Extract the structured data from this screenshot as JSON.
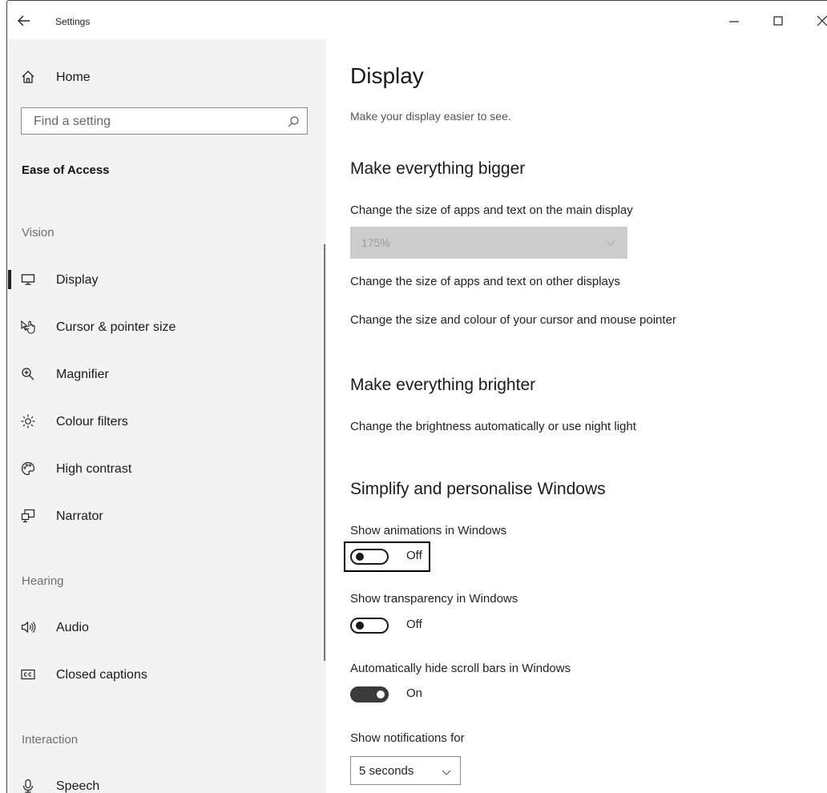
{
  "window": {
    "title": "Settings",
    "controls": {
      "minimize": "minimize-icon",
      "maximize": "maximize-icon",
      "close": "close-icon"
    }
  },
  "sidebar": {
    "home_label": "Home",
    "search_placeholder": "Find a setting",
    "section_title": "Ease of Access",
    "groups": {
      "vision": "Vision",
      "hearing": "Hearing",
      "interaction": "Interaction"
    },
    "items": [
      {
        "label": "Display",
        "icon": "monitor-icon",
        "selected": true
      },
      {
        "label": "Cursor & pointer size",
        "icon": "cursor-pointer-icon"
      },
      {
        "label": "Magnifier",
        "icon": "magnifier-icon"
      },
      {
        "label": "Colour filters",
        "icon": "colour-filters-icon"
      },
      {
        "label": "High contrast",
        "icon": "high-contrast-icon"
      },
      {
        "label": "Narrator",
        "icon": "narrator-icon"
      },
      {
        "label": "Audio",
        "icon": "speaker-icon"
      },
      {
        "label": "Closed captions",
        "icon": "closed-captions-icon"
      },
      {
        "label": "Speech",
        "icon": "microphone-icon"
      }
    ]
  },
  "main": {
    "title": "Display",
    "subtitle": "Make your display easier to see.",
    "bigger": {
      "heading": "Make everything bigger",
      "scale_label": "Change the size of apps and text on the main display",
      "scale_value": "175%",
      "other_displays_link": "Change the size of apps and text on other displays",
      "cursor_link": "Change the size and colour of your cursor and mouse pointer"
    },
    "brighter": {
      "heading": "Make everything brighter",
      "brightness_link": "Change the brightness automatically or use night light"
    },
    "simplify": {
      "heading": "Simplify and personalise Windows",
      "animations": {
        "label": "Show animations in Windows",
        "state": "Off"
      },
      "transparency": {
        "label": "Show transparency in Windows",
        "state": "Off"
      },
      "scrollbars": {
        "label": "Automatically hide scroll bars in Windows",
        "state": "On"
      },
      "notifications": {
        "label": "Show notifications for",
        "value": "5 seconds"
      }
    }
  }
}
